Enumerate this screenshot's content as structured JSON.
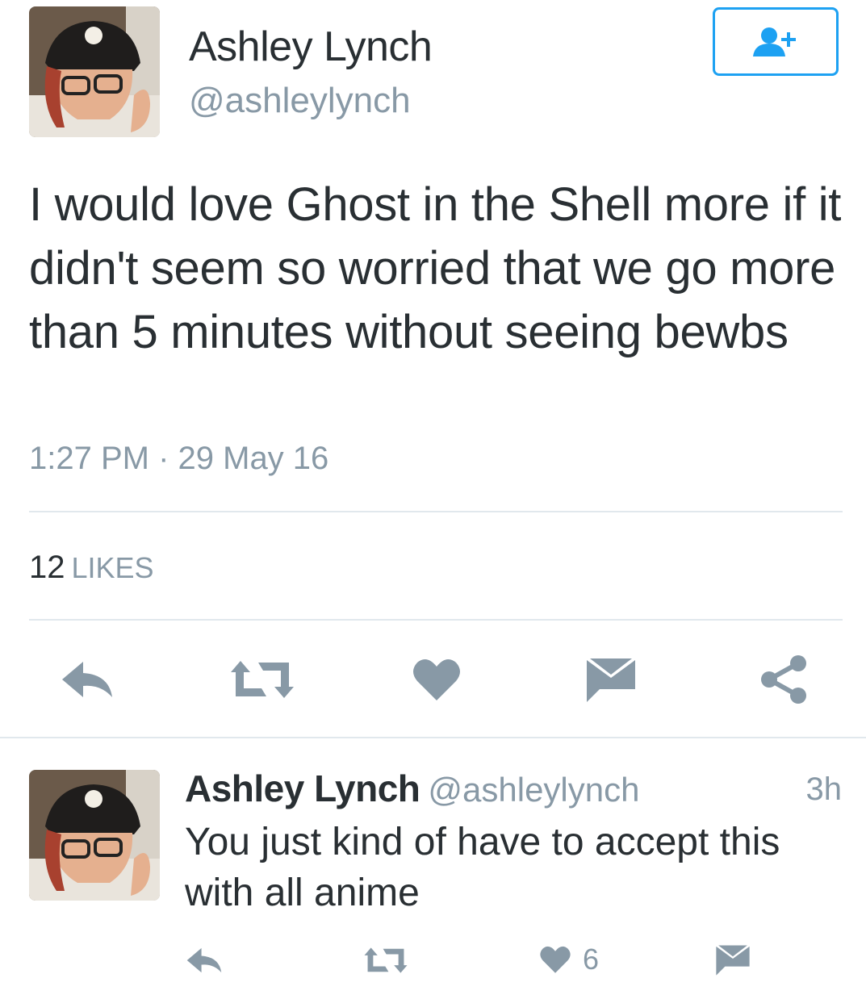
{
  "main_tweet": {
    "author_name": "Ashley Lynch",
    "author_handle": "@ashleylynch",
    "follow_icon": "follow-user-icon",
    "text": "I would love Ghost in the Shell more if it didn't seem so worried that we go more than 5 minutes without seeing bewbs",
    "timestamp": "1:27 PM · 29 May 16",
    "likes_count": "12",
    "likes_label": "LIKES",
    "actions": [
      "reply-icon",
      "retweet-icon",
      "like-icon",
      "direct-message-icon",
      "share-icon"
    ]
  },
  "reply_tweet": {
    "author_name": "Ashley Lynch",
    "author_handle": "@ashleylynch",
    "time_ago": "3h",
    "text": "You just kind of have to accept this with all anime",
    "likes_count": "6",
    "actions": [
      "reply-icon",
      "retweet-icon",
      "like-icon",
      "direct-message-icon"
    ]
  },
  "colors": {
    "accent": "#1da1f2",
    "text": "#292f33",
    "muted": "#8899a6",
    "icon": "#8899a6",
    "divider": "#e1e8ed"
  }
}
